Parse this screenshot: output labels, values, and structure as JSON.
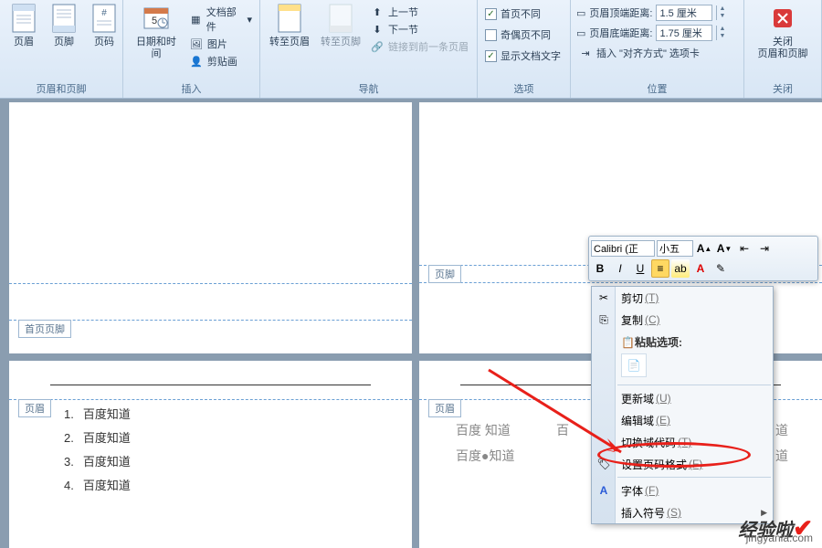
{
  "ribbon": {
    "groups": {
      "header_footer": {
        "label": "页眉和页脚",
        "header_btn": "页眉",
        "footer_btn": "页脚",
        "pagenum_btn": "页码"
      },
      "insert": {
        "label": "插入",
        "datetime_btn": "日期和时间",
        "doc_parts": "文档部件",
        "picture": "图片",
        "clipart": "剪贴画"
      },
      "nav": {
        "label": "导航",
        "goto_header": "转至页眉",
        "goto_footer": "转至页脚",
        "prev_section": "上一节",
        "next_section": "下一节",
        "link_prev": "链接到前一条页眉"
      },
      "options": {
        "label": "选项",
        "diff_first": "首页不同",
        "diff_oddeven": "奇偶页不同",
        "show_text": "显示文档文字"
      },
      "position": {
        "label": "位置",
        "header_dist_label": "页眉顶端距离:",
        "footer_dist_label": "页眉底端距离:",
        "header_dist": "1.5 厘米",
        "footer_dist": "1.75 厘米",
        "insert_align": "插入 \"对齐方式\" 选项卡"
      },
      "close": {
        "label": "关闭",
        "btn_line1": "关闭",
        "btn_line2": "页眉和页脚"
      }
    }
  },
  "doc": {
    "first_footer_tab": "首页页脚",
    "footer_tab": "页脚",
    "header_tab": "页眉",
    "list": [
      {
        "n": "1.",
        "t": "百度知道"
      },
      {
        "n": "2.",
        "t": "百度知道"
      },
      {
        "n": "3.",
        "t": "百度知道"
      },
      {
        "n": "4.",
        "t": "百度知道"
      }
    ],
    "faded1": "百度 知道",
    "faded2": "百度●知道",
    "faded3": "百",
    "faded4": "道"
  },
  "mini": {
    "font": "Calibri (正",
    "size": "小五"
  },
  "ctx": {
    "cut": "剪切",
    "cut_k": "(T)",
    "copy": "复制",
    "copy_k": "(C)",
    "paste_hdr": "粘贴选项:",
    "update_field": "更新域",
    "update_field_k": "(U)",
    "edit_field": "编辑域",
    "edit_field_k": "(E)",
    "toggle_code": "切换域代码",
    "toggle_code_k": "(T)",
    "format_pagenum": "设置页码格式",
    "format_pagenum_k": "(F)",
    "font": "字体",
    "font_k": "(F)",
    "symbol": "插入符号",
    "symbol_k": "(S)"
  },
  "watermark": {
    "brand": "经验啦",
    "url": "jingyanla.com"
  }
}
